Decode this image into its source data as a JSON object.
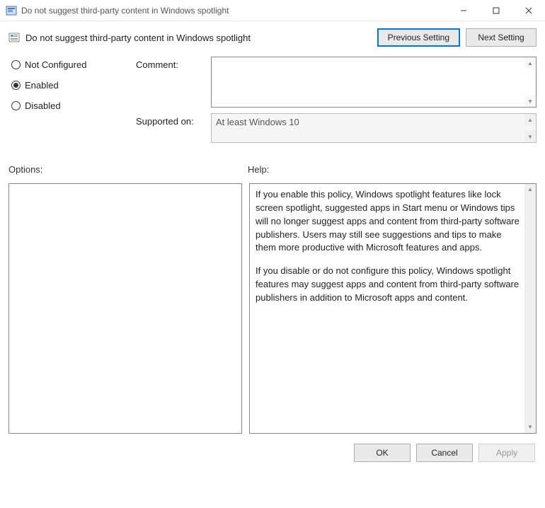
{
  "window": {
    "title": "Do not suggest third-party content in Windows spotlight"
  },
  "header": {
    "title": "Do not suggest third-party content in Windows spotlight",
    "prev_btn": "Previous Setting",
    "next_btn": "Next Setting"
  },
  "state": {
    "not_configured": "Not Configured",
    "enabled": "Enabled",
    "disabled": "Disabled",
    "selected": "enabled"
  },
  "fields": {
    "comment_label": "Comment:",
    "comment_value": "",
    "supported_label": "Supported on:",
    "supported_value": "At least Windows 10"
  },
  "sections": {
    "options_label": "Options:",
    "help_label": "Help:"
  },
  "help": {
    "p1": "If you enable this policy, Windows spotlight features like lock screen spotlight, suggested apps in Start menu or Windows tips will no longer suggest apps and content from third-party software publishers. Users may still see suggestions and tips to make them more productive with Microsoft features and apps.",
    "p2": "If you disable or do not configure this policy, Windows spotlight features may suggest apps and content from third-party software publishers in addition to Microsoft apps and content."
  },
  "footer": {
    "ok": "OK",
    "cancel": "Cancel",
    "apply": "Apply"
  }
}
